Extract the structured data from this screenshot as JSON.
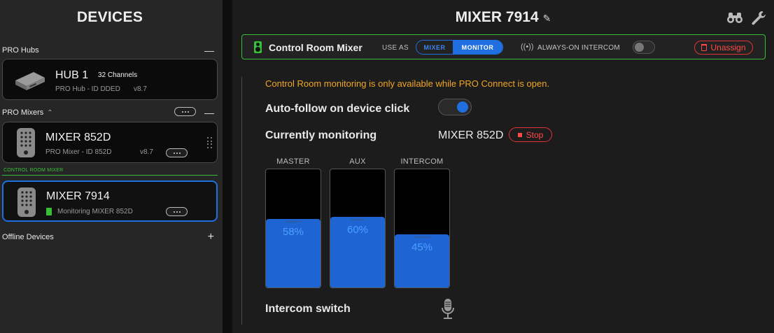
{
  "sidebar": {
    "title": "DEVICES",
    "hubs_section": "PRO Hubs",
    "hub": {
      "name": "HUB 1",
      "channels": "32 Channels",
      "sub": "PRO Hub - ID DDED",
      "version": "v8.7"
    },
    "mixers_section": "PRO Mixers",
    "mixer1": {
      "name": "MIXER 852D",
      "sub": "PRO Mixer - ID 852D",
      "version": "v8.7"
    },
    "control_room_label": "CONTROL ROOM MIXER",
    "mixer2": {
      "name": "MIXER 7914",
      "sub": "Monitoring MIXER 852D"
    },
    "offline_section": "Offline Devices"
  },
  "main": {
    "title": "MIXER 7914",
    "bar": {
      "name": "Control Room Mixer",
      "use_as": "USE AS",
      "opt_mixer": "MIXER",
      "opt_monitor": "MONITOR",
      "selected": "MONITOR",
      "always_on": "ALWAYS-ON INTERCOM",
      "always_on_enabled": false,
      "unassign": "Unassign"
    },
    "warning": "Control Room monitoring is only available while PRO Connect is open.",
    "auto_follow_label": "Auto-follow on device click",
    "auto_follow_enabled": true,
    "currently_monitoring_label": "Currently monitoring",
    "currently_monitoring_value": "MIXER 852D",
    "stop": "Stop",
    "meters": [
      {
        "label": "MASTER",
        "value_text": "58%",
        "level": 0.58
      },
      {
        "label": "AUX",
        "value_text": "60%",
        "level": 0.6
      },
      {
        "label": "INTERCOM",
        "value_text": "45%",
        "level": 0.45
      }
    ],
    "intercom_label": "Intercom switch"
  },
  "colors": {
    "accent_blue": "#1f6fe0",
    "green": "#36c03a",
    "red": "#e03434",
    "warning": "#f2a622"
  }
}
